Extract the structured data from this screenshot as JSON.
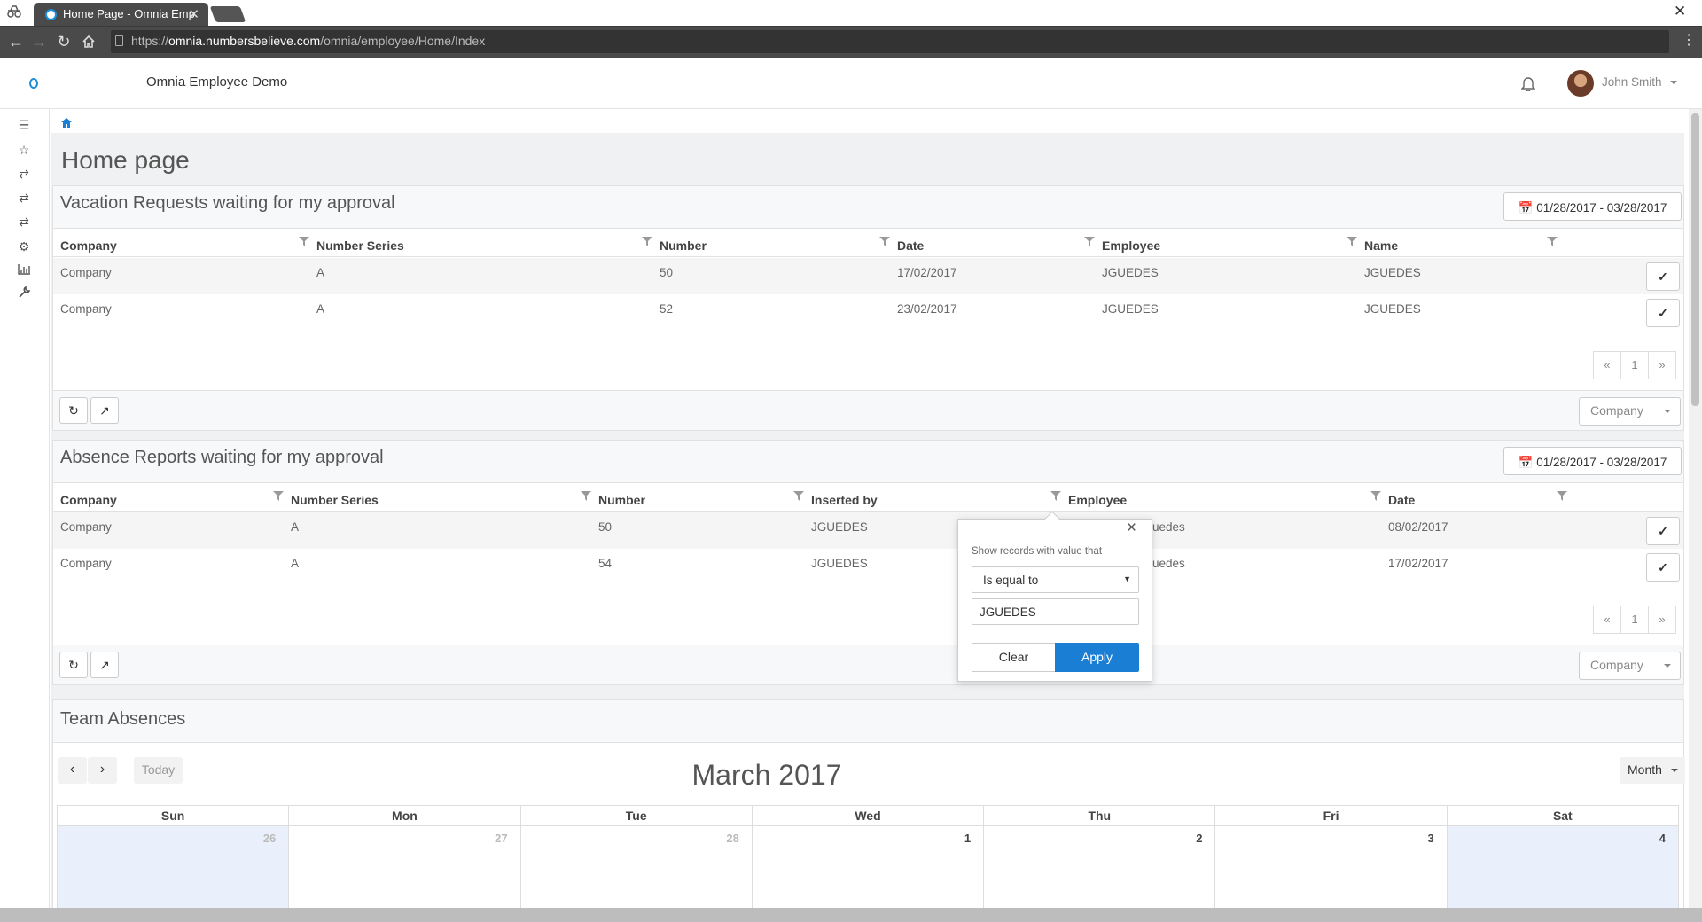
{
  "browser": {
    "tab_title": "Home Page - Omnia Emp",
    "url_scheme": "https://",
    "url_host": "omnia.numbersbelieve.com",
    "url_path": "/omnia/employee/Home/Index"
  },
  "header": {
    "app_title": "Omnia Employee Demo",
    "user_name": "John Smith"
  },
  "page": {
    "title": "Home page"
  },
  "vacation": {
    "title": "Vacation Requests waiting for my approval",
    "date_range": "01/28/2017 - 03/28/2017",
    "columns": [
      "Company",
      "Number Series",
      "Number",
      "Date",
      "Employee",
      "Name"
    ],
    "rows": [
      [
        "Company",
        "A",
        "50",
        "17/02/2017",
        "JGUEDES",
        "JGUEDES"
      ],
      [
        "Company",
        "A",
        "52",
        "23/02/2017",
        "JGUEDES",
        "JGUEDES"
      ]
    ],
    "pager": {
      "prev": "«",
      "page": "1",
      "next": "»"
    },
    "company_dropdown": "Company"
  },
  "absence": {
    "title": "Absence Reports waiting for my approval",
    "date_range": "01/28/2017 - 03/28/2017",
    "columns": [
      "Company",
      "Number Series",
      "Number",
      "Inserted by",
      "Employee",
      "Date"
    ],
    "rows": [
      [
        "Company",
        "A",
        "50",
        "JGUEDES",
        "uedes",
        "08/02/2017"
      ],
      [
        "Company",
        "A",
        "54",
        "JGUEDES",
        "uedes",
        "17/02/2017"
      ]
    ],
    "pager": {
      "prev": "«",
      "page": "1",
      "next": "»"
    },
    "company_dropdown": "Company"
  },
  "filter_popup": {
    "label": "Show records with value that",
    "operator": "Is equal to",
    "value": "JGUEDES",
    "clear_label": "Clear",
    "apply_label": "Apply",
    "close": "×"
  },
  "team": {
    "title": "Team Absences",
    "today_label": "Today",
    "month_title": "March 2017",
    "view_label": "Month",
    "weekdays": [
      "Sun",
      "Mon",
      "Tue",
      "Wed",
      "Thu",
      "Fri",
      "Sat"
    ],
    "first_week": [
      "26",
      "27",
      "28",
      "1",
      "2",
      "3",
      "4"
    ]
  },
  "colors": {
    "primary": "#1a7fd4",
    "weekend": "#eaf0fb"
  }
}
